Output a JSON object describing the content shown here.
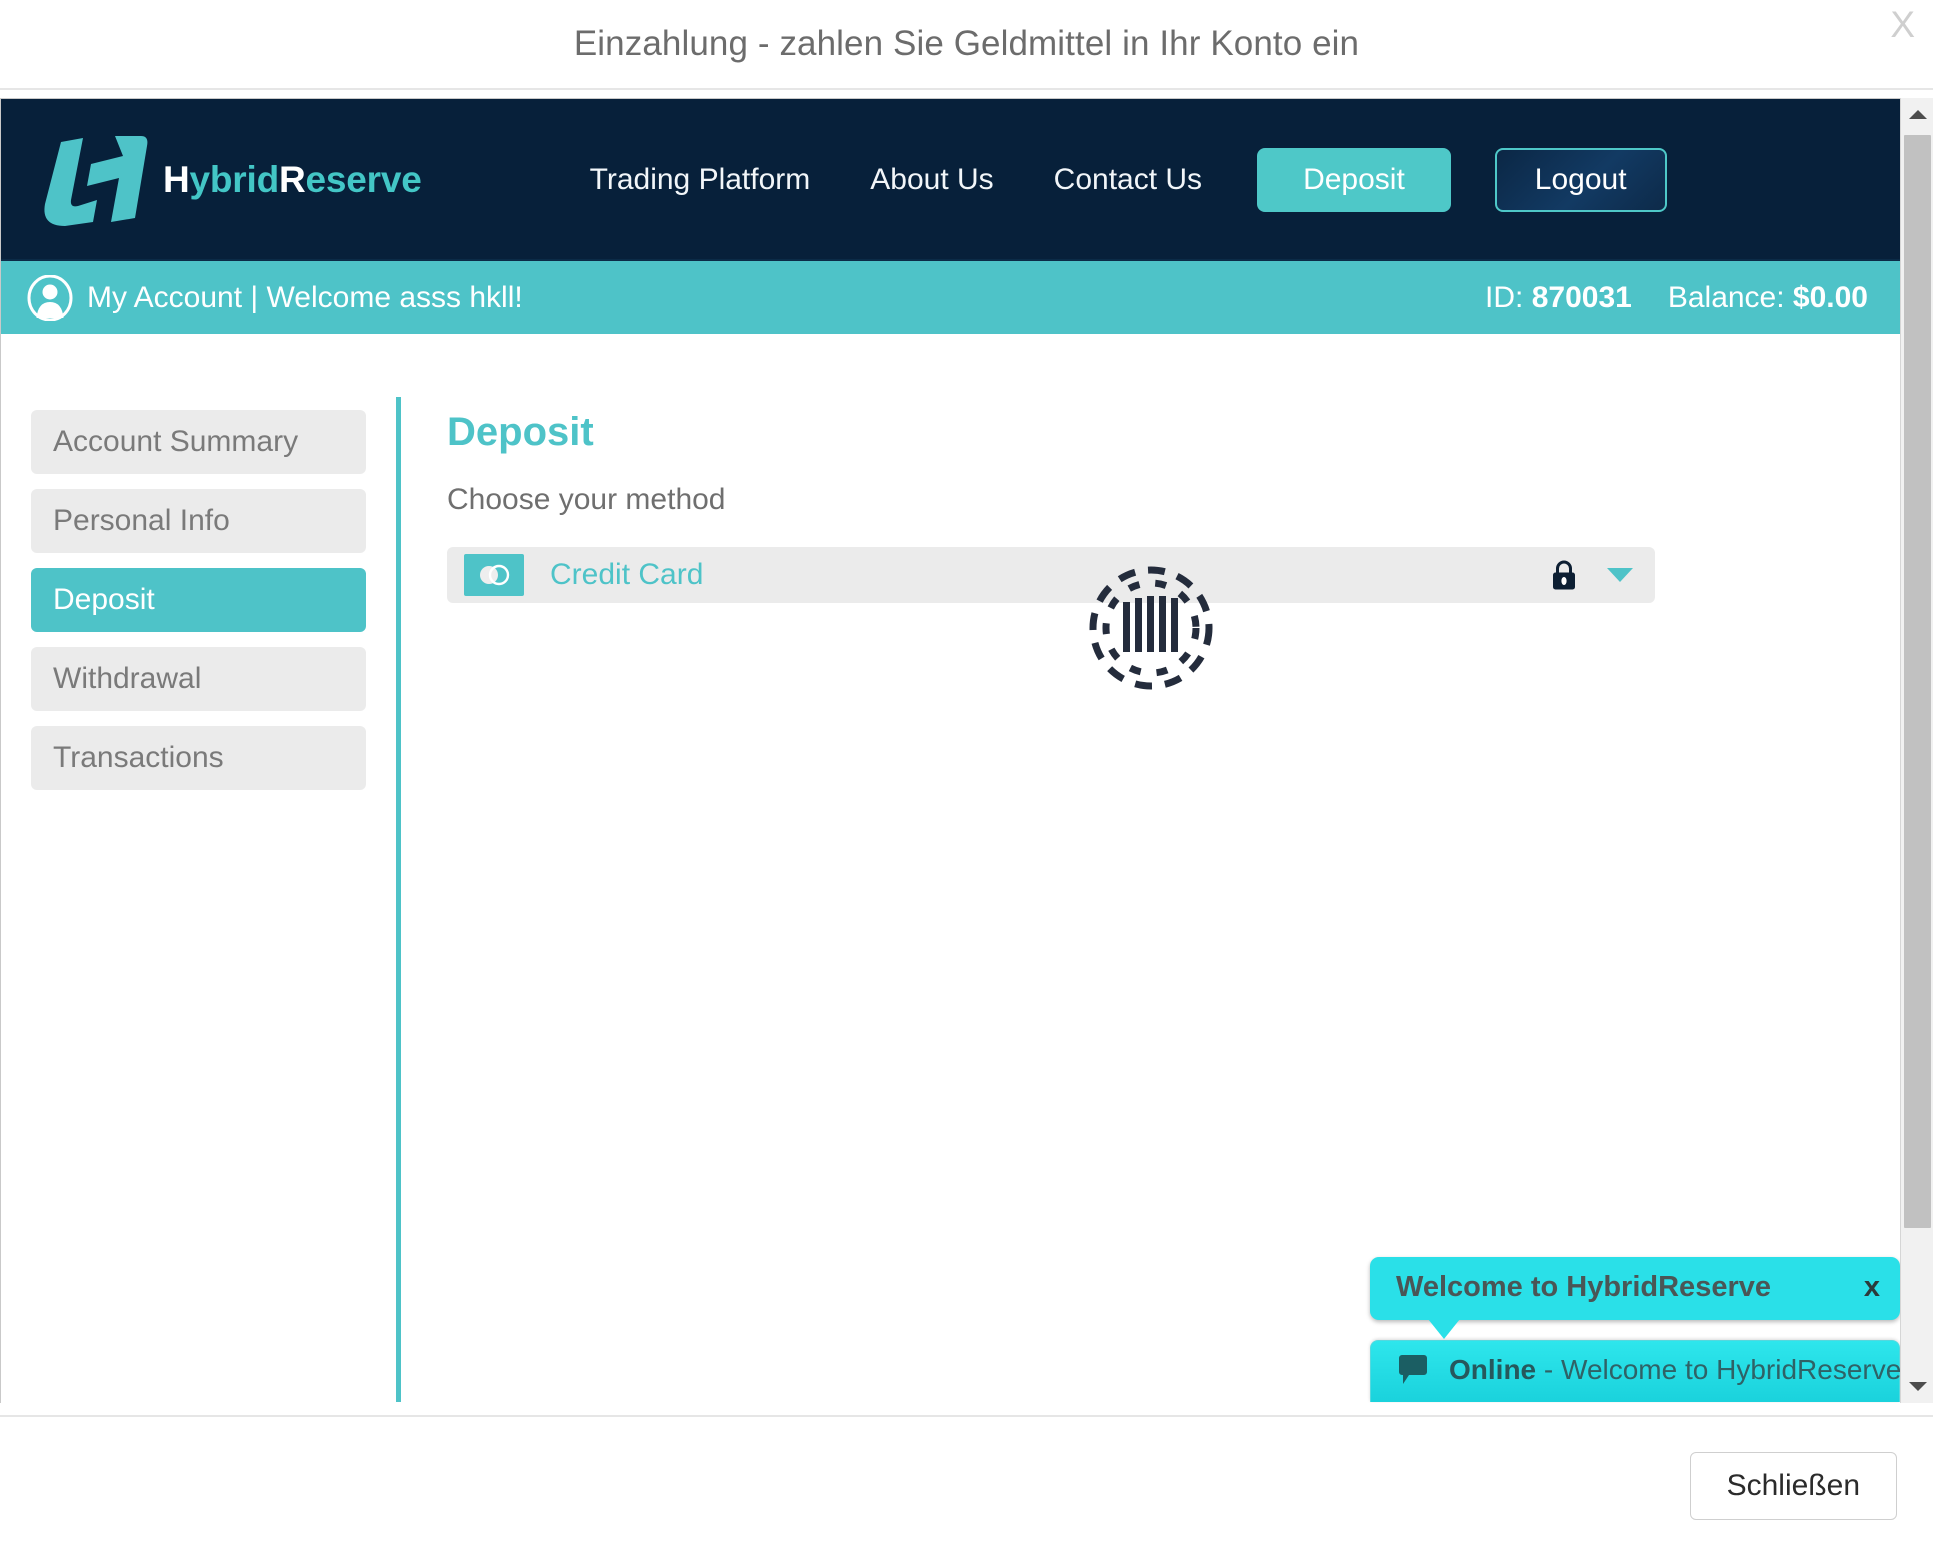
{
  "modal": {
    "title": "Einzahlung - zahlen Sie Geldmittel in Ihr Konto ein",
    "close_x": "X",
    "footer_close_label": "Schließen"
  },
  "nav": {
    "brand_cap1": "H",
    "brand_part1": "ybrid",
    "brand_cap2": "R",
    "brand_part2": "eserve",
    "brand_full": "HybridReserve",
    "links": [
      {
        "label": "Trading Platform"
      },
      {
        "label": "About Us"
      },
      {
        "label": "Contact Us"
      }
    ],
    "deposit_label": "Deposit",
    "logout_label": "Logout"
  },
  "account_bar": {
    "welcome": "My Account | Welcome asss hkll!",
    "id_label": "ID:",
    "id_value": "870031",
    "balance_label": "Balance:",
    "balance_value": "$0.00"
  },
  "sidebar": {
    "items": [
      {
        "label": "Account Summary",
        "active": false
      },
      {
        "label": "Personal Info",
        "active": false
      },
      {
        "label": "Deposit",
        "active": true
      },
      {
        "label": "Withdrawal",
        "active": false
      },
      {
        "label": "Transactions",
        "active": false
      }
    ]
  },
  "main": {
    "title": "Deposit",
    "subtitle": "Choose your method",
    "method_selected": "Credit Card",
    "loading": true
  },
  "chat": {
    "bubble_text": "Welcome to HybridReserve",
    "bubble_close": "x",
    "status": "Online",
    "separator": " - ",
    "status_message": "Welcome to HybridReserve"
  },
  "colors": {
    "brand_teal": "#4ec3c8",
    "nav_dark": "#07203a",
    "chat_cyan": "#2ae0e8",
    "sidebar_gray": "#ebebeb",
    "spinner_navy": "#242c3c"
  }
}
